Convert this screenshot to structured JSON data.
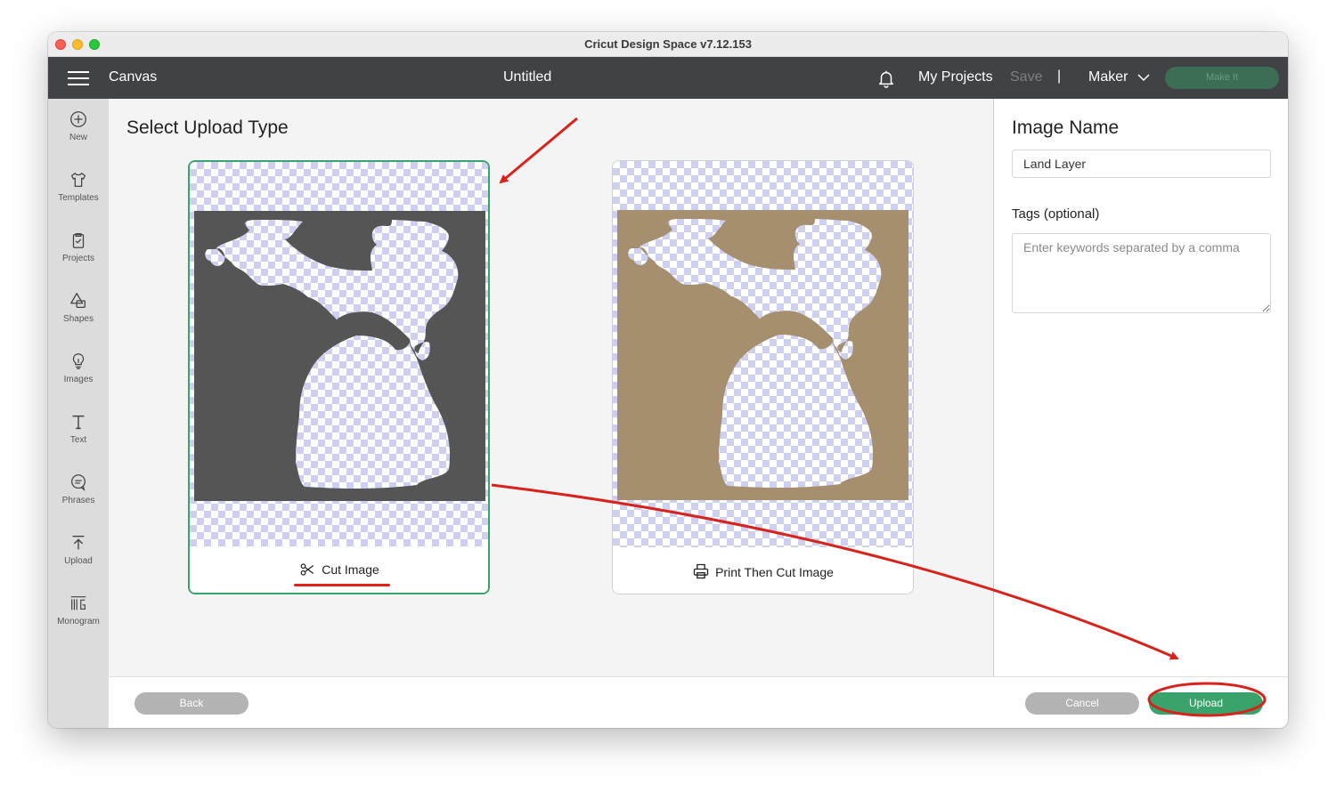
{
  "window": {
    "title": "Cricut Design Space  v7.12.153"
  },
  "topbar": {
    "section": "Canvas",
    "doc_title": "Untitled",
    "my_projects": "My Projects",
    "save": "Save",
    "separator": "|",
    "machine": "Maker",
    "make_it": "Make It"
  },
  "sidebar": {
    "items": [
      {
        "label": "New",
        "icon": "plus-circle-icon"
      },
      {
        "label": "Templates",
        "icon": "shirt-icon"
      },
      {
        "label": "Projects",
        "icon": "clipboard-icon"
      },
      {
        "label": "Shapes",
        "icon": "shapes-icon"
      },
      {
        "label": "Images",
        "icon": "lightbulb-icon"
      },
      {
        "label": "Text",
        "icon": "text-icon"
      },
      {
        "label": "Phrases",
        "icon": "speech-bubble-icon"
      },
      {
        "label": "Upload",
        "icon": "upload-icon"
      },
      {
        "label": "Monogram",
        "icon": "monogram-icon"
      }
    ]
  },
  "main": {
    "title": "Select Upload Type",
    "options": [
      {
        "label": "Cut Image",
        "icon": "scissors-icon",
        "selected": true,
        "fill": "#555555"
      },
      {
        "label": "Print Then Cut Image",
        "icon": "printer-icon",
        "selected": false,
        "fill": "#a58f6e"
      }
    ]
  },
  "right_panel": {
    "image_name_title": "Image Name",
    "image_name_value": "Land Layer",
    "tags_label": "Tags (optional)",
    "tags_placeholder": "Enter keywords separated by a comma"
  },
  "bottom": {
    "back": "Back",
    "cancel": "Cancel",
    "upload": "Upload"
  },
  "colors": {
    "accent": "#3aa36c",
    "annotation": "#d8231c",
    "topbar": "#404245"
  }
}
